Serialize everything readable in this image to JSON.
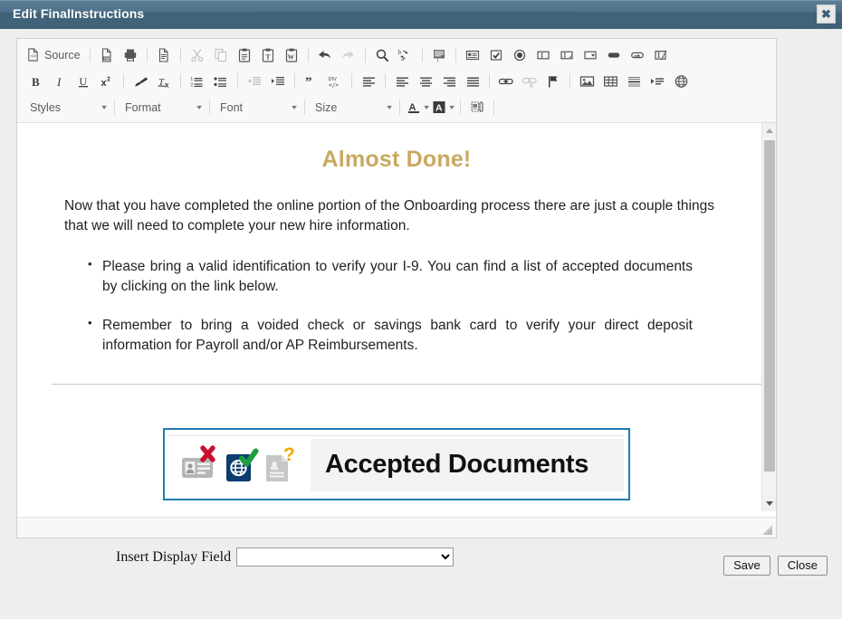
{
  "window": {
    "title": "Edit FinalInstructions",
    "close_label": "✖",
    "close_icon": "close-icon"
  },
  "editor": {
    "toolbar": {
      "source_label": "Source",
      "row1": [
        {
          "name": "source-button",
          "label": "Source",
          "icon": "source-code-icon",
          "disabled": false
        },
        {
          "name": "separator",
          "icon": "separator"
        },
        {
          "name": "pdf-button",
          "label": "PDF",
          "icon": "pdf-icon",
          "disabled": false
        },
        {
          "name": "print-button",
          "label": "Print",
          "icon": "printer-icon",
          "disabled": false
        },
        {
          "name": "separator",
          "icon": "separator"
        },
        {
          "name": "new-page-button",
          "label": "New Page",
          "icon": "new-page-icon",
          "disabled": false
        },
        {
          "name": "separator",
          "icon": "separator"
        },
        {
          "name": "cut-button",
          "label": "Cut",
          "icon": "scissors-icon",
          "disabled": true
        },
        {
          "name": "copy-button",
          "label": "Copy",
          "icon": "copy-icon",
          "disabled": true
        },
        {
          "name": "paste-button",
          "label": "Paste",
          "icon": "clipboard-icon",
          "disabled": false
        },
        {
          "name": "paste-text-button",
          "label": "Paste as plain text",
          "icon": "clipboard-text-icon",
          "disabled": false
        },
        {
          "name": "paste-word-button",
          "label": "Paste from Word",
          "icon": "clipboard-word-icon",
          "disabled": false
        },
        {
          "name": "separator",
          "icon": "separator"
        },
        {
          "name": "undo-button",
          "label": "Undo",
          "icon": "undo-arrow-icon",
          "disabled": false
        },
        {
          "name": "redo-button",
          "label": "Redo",
          "icon": "redo-arrow-icon",
          "disabled": true
        },
        {
          "name": "separator",
          "icon": "separator"
        },
        {
          "name": "find-button",
          "label": "Find",
          "icon": "magnifier-icon",
          "disabled": false
        },
        {
          "name": "replace-button",
          "label": "Replace",
          "icon": "find-replace-icon",
          "disabled": false
        },
        {
          "name": "separator",
          "icon": "separator"
        },
        {
          "name": "select-all-button",
          "label": "Select All",
          "icon": "select-all-icon",
          "disabled": false
        },
        {
          "name": "separator",
          "icon": "separator"
        },
        {
          "name": "form-button",
          "label": "Form",
          "icon": "form-icon",
          "disabled": false
        },
        {
          "name": "checkbox-button",
          "label": "Checkbox",
          "icon": "checkbox-icon",
          "disabled": false
        },
        {
          "name": "radio-button-button",
          "label": "Radio Button",
          "icon": "radio-button-icon",
          "disabled": false
        },
        {
          "name": "text-field-button",
          "label": "Text Field",
          "icon": "text-field-icon",
          "disabled": false
        },
        {
          "name": "textarea-button",
          "label": "Textarea",
          "icon": "textarea-icon",
          "disabled": false
        },
        {
          "name": "selection-field-button",
          "label": "Selection Field",
          "icon": "select-dropdown-icon",
          "disabled": false
        },
        {
          "name": "button-button",
          "label": "Button",
          "icon": "push-button-icon",
          "disabled": false
        },
        {
          "name": "image-button-button",
          "label": "Image Button",
          "icon": "image-button-icon",
          "disabled": false
        },
        {
          "name": "hidden-field-button",
          "label": "Hidden Field",
          "icon": "hidden-field-icon",
          "disabled": false
        }
      ],
      "row2": [
        {
          "name": "bold-button",
          "label": "Bold",
          "icon": "bold-icon",
          "disabled": false
        },
        {
          "name": "italic-button",
          "label": "Italic",
          "icon": "italic-icon",
          "disabled": false
        },
        {
          "name": "underline-button",
          "label": "Underline",
          "icon": "underline-icon",
          "disabled": false
        },
        {
          "name": "superscript-button",
          "label": "Superscript",
          "icon": "superscript-icon",
          "disabled": false
        },
        {
          "name": "separator",
          "icon": "separator"
        },
        {
          "name": "copy-formatting-button",
          "label": "Copy Formatting",
          "icon": "paintbrush-icon",
          "disabled": false
        },
        {
          "name": "remove-format-button",
          "label": "Remove Format",
          "icon": "remove-format-icon",
          "disabled": false
        },
        {
          "name": "separator",
          "icon": "separator"
        },
        {
          "name": "numbered-list-button",
          "label": "Insert/Remove Numbered List",
          "icon": "numbered-list-icon",
          "disabled": false
        },
        {
          "name": "bulleted-list-button",
          "label": "Insert/Remove Bulleted List",
          "icon": "bulleted-list-icon",
          "disabled": false
        },
        {
          "name": "separator",
          "icon": "separator"
        },
        {
          "name": "decrease-indent-button",
          "label": "Decrease Indent",
          "icon": "outdent-icon",
          "disabled": true
        },
        {
          "name": "increase-indent-button",
          "label": "Increase Indent",
          "icon": "indent-icon",
          "disabled": false
        },
        {
          "name": "separator",
          "icon": "separator"
        },
        {
          "name": "blockquote-button",
          "label": "Block Quote",
          "icon": "quote-icon",
          "disabled": false
        },
        {
          "name": "div-container-button",
          "label": "Create Div Container",
          "icon": "div-container-icon",
          "disabled": false
        },
        {
          "name": "separator",
          "icon": "separator"
        },
        {
          "name": "align-left-button",
          "label": "Align Left",
          "icon": "align-left-icon",
          "disabled": false
        },
        {
          "name": "separator",
          "icon": "separator"
        },
        {
          "name": "align-left-2-button",
          "label": "Align Left",
          "icon": "align-left-icon",
          "disabled": false
        },
        {
          "name": "align-center-button",
          "label": "Center",
          "icon": "align-center-icon",
          "disabled": false
        },
        {
          "name": "align-right-button",
          "label": "Align Right",
          "icon": "align-right-icon",
          "disabled": false
        },
        {
          "name": "justify-button",
          "label": "Justify",
          "icon": "align-justify-icon",
          "disabled": false
        },
        {
          "name": "separator",
          "icon": "separator"
        },
        {
          "name": "link-button",
          "label": "Link",
          "icon": "chain-link-icon",
          "disabled": false
        },
        {
          "name": "unlink-button",
          "label": "Unlink",
          "icon": "broken-link-icon",
          "disabled": true
        },
        {
          "name": "anchor-button",
          "label": "Anchor",
          "icon": "flag-icon",
          "disabled": false
        },
        {
          "name": "separator",
          "icon": "separator"
        },
        {
          "name": "image-button",
          "label": "Image",
          "icon": "picture-icon",
          "disabled": false
        },
        {
          "name": "table-button",
          "label": "Table",
          "icon": "table-icon",
          "disabled": false
        },
        {
          "name": "horizontal-rule-button",
          "label": "Horizontal Line",
          "icon": "horizontal-rule-icon",
          "disabled": false
        },
        {
          "name": "page-break-button",
          "label": "Page Break",
          "icon": "page-break-icon",
          "disabled": false
        },
        {
          "name": "iframe-button",
          "label": "IFrame",
          "icon": "globe-icon",
          "disabled": false
        }
      ],
      "combos": [
        {
          "name": "styles-combo",
          "label": "Styles"
        },
        {
          "name": "format-combo",
          "label": "Format"
        },
        {
          "name": "font-combo",
          "label": "Font"
        },
        {
          "name": "size-combo",
          "label": "Size"
        }
      ],
      "text_color_label": "A",
      "bg_color_label": "A",
      "text_color_name": "text-color-button",
      "bg_color_name": "background-color-button",
      "show_blocks_name": "show-blocks-button"
    },
    "document": {
      "heading": "Almost Done!",
      "heading_color": "#c8a961",
      "intro": "Now that you have completed the online portion of the Onboarding process there are just a couple things that we will need to complete your new hire information.",
      "bullets": [
        "Please bring a valid identification to verify your I-9.   You can find a list of accepted documents by clicking on the link below.",
        "Remember to bring a voided check or savings bank card to verify your direct deposit information for Payroll and/or AP Reimbursements."
      ],
      "banner": {
        "title": "Accepted Documents",
        "border_color": "#1f7eb0",
        "icons": [
          {
            "name": "id-card-rejected-icon",
            "base_color": "#b6b6b6",
            "mark_color": "#c8102e",
            "mark": "X"
          },
          {
            "name": "passport-accepted-icon",
            "base_color": "#0b3d6e",
            "mark_color": "#1e9e3e",
            "mark": "✓"
          },
          {
            "name": "document-question-icon",
            "base_color": "#c6c6c6",
            "mark_color": "#f2a900",
            "mark": "?"
          }
        ]
      }
    },
    "scrollbar": {
      "up_name": "scroll-up-arrow",
      "down_name": "scroll-down-arrow",
      "thumb_name": "scroll-thumb"
    }
  },
  "bottom_bar": {
    "insert_field_label": "Insert Display Field",
    "insert_field_value": "",
    "insert_field_placeholder": "",
    "save_label": "Save",
    "close_label": "Close"
  }
}
